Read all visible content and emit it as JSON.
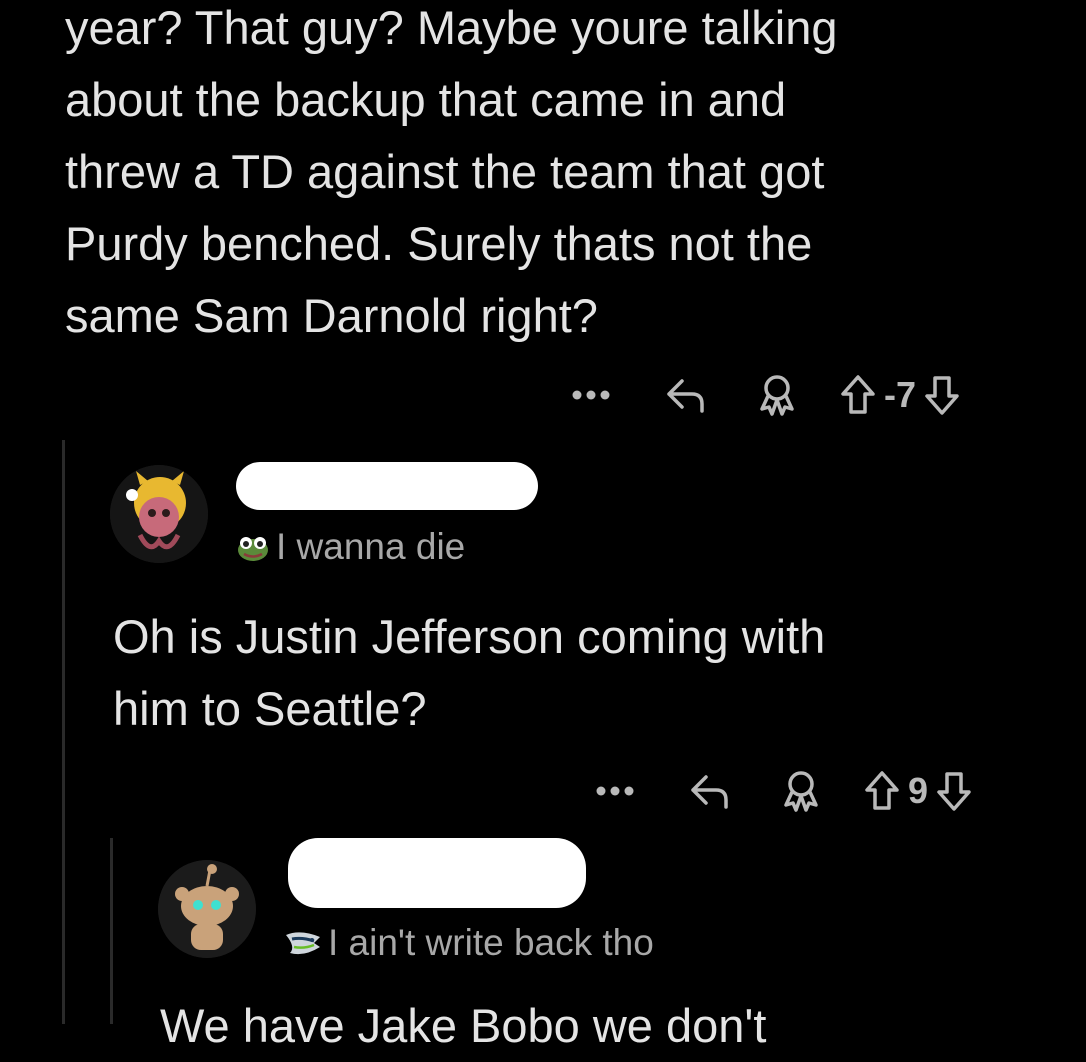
{
  "parent_comment": {
    "text": "year? That guy? Maybe youre talking\nabout the backup that came in and\nthrew a TD against the team that got\nPurdy benched. Surely thats not the\nsame Sam Darnold right?",
    "score": "-7"
  },
  "reply_1": {
    "flair": "I wanna die",
    "flair_icon": "frog-emoji-icon",
    "text": "Oh is Justin Jefferson coming with\nhim to Seattle?",
    "score": "9"
  },
  "reply_2": {
    "flair": "I ain't write back tho",
    "flair_icon": "seahawks-logo-icon",
    "text_partial": "We have Jake Bobo we don't"
  },
  "colors": {
    "background": "#000000",
    "text": "#e4e4e4",
    "muted": "#b9b9b9",
    "thread_line": "#2a2a2a"
  }
}
